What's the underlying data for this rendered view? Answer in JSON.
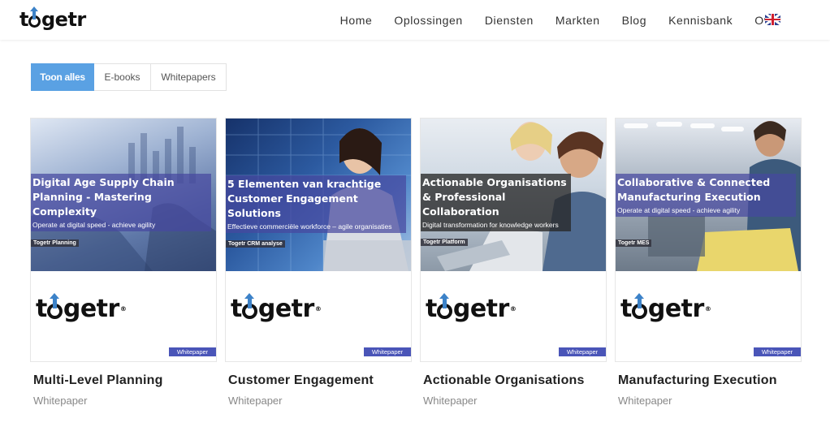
{
  "header": {
    "logo": "togetr",
    "nav": [
      "Home",
      "Oplossingen",
      "Diensten",
      "Markten",
      "Blog",
      "Kennisbank",
      "Over"
    ],
    "language_flag": "uk-flag-icon"
  },
  "filters": [
    {
      "label": "Toon alles",
      "active": true
    },
    {
      "label": "E-books",
      "active": false
    },
    {
      "label": "Whitepapers",
      "active": false
    }
  ],
  "cards": [
    {
      "cover_title": "Digital Age Supply Chain Planning - Mastering Complexity",
      "cover_subtitle": "Operate at digital speed - achieve agility",
      "cover_tag": "Togetr Planning",
      "cover_logo": "togetr",
      "badge": "Whitepaper",
      "title": "Multi-Level Planning",
      "type": "Whitepaper"
    },
    {
      "cover_title": "5 Elementen van krachtige Customer Engagement Solutions",
      "cover_subtitle": "Effectieve commerciële workforce – agile organisaties",
      "cover_tag": "Togetr CRM analyse",
      "cover_logo": "togetr",
      "badge": "Whitepaper",
      "title": "Customer Engagement",
      "type": "Whitepaper"
    },
    {
      "cover_title": "Actionable Organisations & Professional Collaboration",
      "cover_subtitle": "Digital transformation for knowledge workers",
      "cover_tag": "Togetr Platform",
      "cover_logo": "togetr",
      "badge": "Whitepaper",
      "title": "Actionable Organisations",
      "type": "Whitepaper"
    },
    {
      "cover_title": "Collaborative & Connected Manufacturing Execution",
      "cover_subtitle": "Operate at digital speed - achieve agility",
      "cover_tag": "Togetr MES",
      "cover_logo": "togetr",
      "badge": "Whitepaper",
      "title": "Manufacturing Execution",
      "type": "Whitepaper"
    }
  ],
  "colors": {
    "accent": "#5aa1e3",
    "badge": "#4a55b8",
    "band": "#4648a0",
    "logo_arrow": "#3c82c8"
  }
}
